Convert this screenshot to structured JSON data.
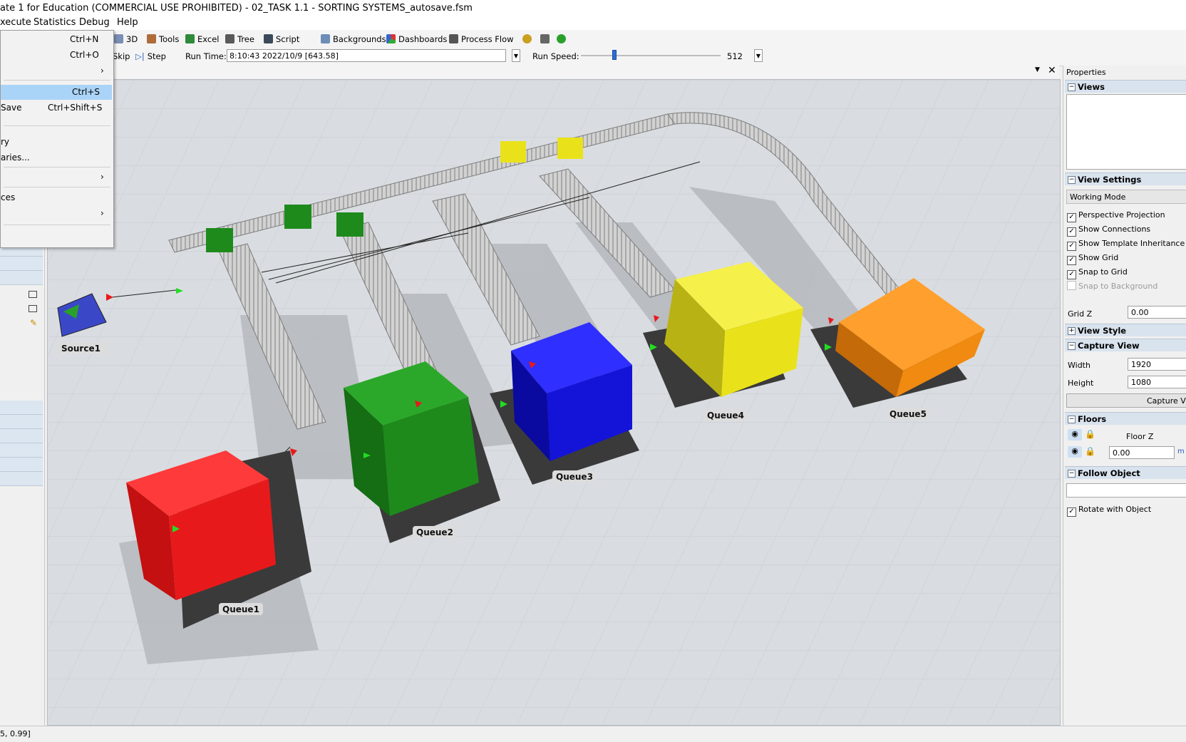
{
  "window": {
    "title": "ate 1 for Education (COMMERCIAL USE PROHIBITED) - 02_TASK 1.1 - SORTING SYSTEMS_autosave.fsm"
  },
  "menubar": {
    "items": [
      "xecute",
      "Statistics",
      "Debug",
      "Help"
    ]
  },
  "file_menu": {
    "items": [
      {
        "label": "",
        "shortcut": "Ctrl+N",
        "arrow": ""
      },
      {
        "label": "",
        "shortcut": "Ctrl+O",
        "arrow": ""
      },
      {
        "label": "",
        "shortcut": "",
        "arrow": "›"
      },
      {
        "label": "",
        "shortcut": "Ctrl+S",
        "arrow": ""
      },
      {
        "label": "Save",
        "shortcut": "Ctrl+Shift+S",
        "arrow": ""
      },
      {
        "label": "ry",
        "shortcut": "",
        "arrow": ""
      },
      {
        "label": "aries...",
        "shortcut": "",
        "arrow": ""
      },
      {
        "label": "",
        "shortcut": "",
        "arrow": "›"
      },
      {
        "label": "ces",
        "shortcut": "",
        "arrow": ""
      },
      {
        "label": "",
        "shortcut": "",
        "arrow": "›"
      }
    ]
  },
  "toolbar": {
    "view3d": "3D",
    "tools": "Tools",
    "excel": "Excel",
    "tree": "Tree",
    "script": "Script",
    "backgrounds": "Backgrounds",
    "dashboards": "Dashboards",
    "process_flow": "Process Flow",
    "skip": "Skip",
    "step": "Step",
    "run_time_label": "Run Time:",
    "run_time_value": "8:10:43  2022/10/9  [643.58]",
    "run_speed_label": "Run Speed:",
    "run_speed_value": "512",
    "run_speed_level": 0.24
  },
  "viewport": {
    "labels": {
      "source1": "Source1",
      "queue1": "Queue1",
      "queue2": "Queue2",
      "queue3": "Queue3",
      "queue4": "Queue4",
      "queue5": "Queue5"
    },
    "colors": {
      "red": "#e8191b",
      "green": "#1e8a1c",
      "blue": "#1414d8",
      "yellow": "#e9e21a",
      "orange": "#f08a10",
      "source": "#3a48c8"
    }
  },
  "properties": {
    "title": "Properties",
    "views_header": "Views",
    "view_settings_header": "View Settings",
    "working_mode": "Working Mode",
    "checks": [
      {
        "label": "Perspective Projection",
        "checked": true
      },
      {
        "label": "Show Connections",
        "checked": true
      },
      {
        "label": "Show Template Inheritance (T)",
        "checked": true
      },
      {
        "label": "Show Grid",
        "checked": true
      },
      {
        "label": "Snap to Grid",
        "checked": true
      },
      {
        "label": "Snap to Background",
        "checked": false
      }
    ],
    "grid_z_label": "Grid Z",
    "grid_z_value": "0.00",
    "view_style_header": "View Style",
    "capture_view_header": "Capture View",
    "width_label": "Width",
    "width_value": "1920",
    "height_label": "Height",
    "height_value": "1080",
    "capture_button": "Capture Vie",
    "floors_header": "Floors",
    "floor_z_label": "Floor Z",
    "floor_z_value": "0.00",
    "floor_unit": "m",
    "follow_header": "Follow Object",
    "rotate_label": "Rotate with Object"
  },
  "status": {
    "text": "5, 0.99]"
  }
}
